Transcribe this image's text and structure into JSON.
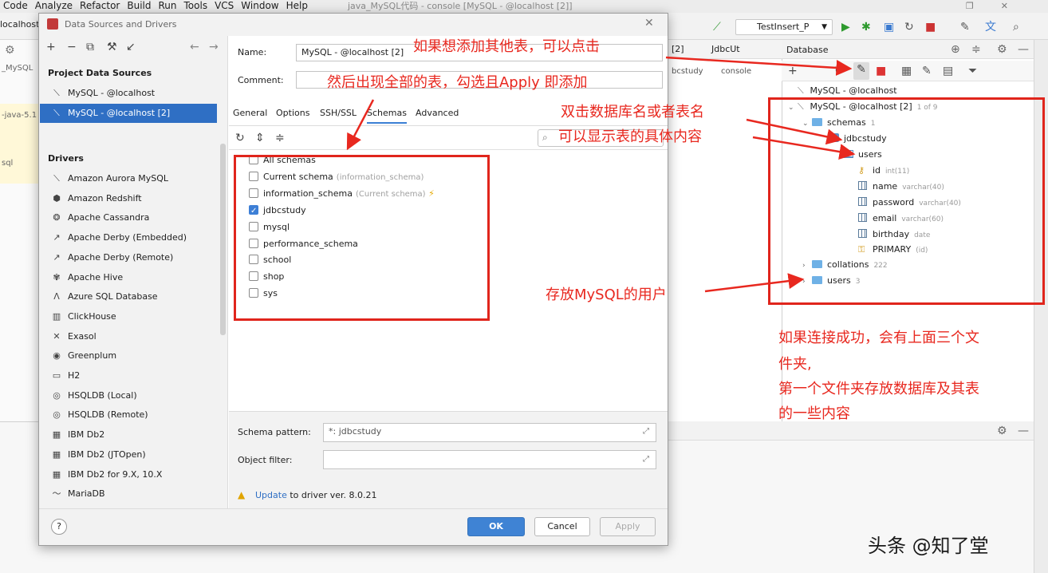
{
  "ide": {
    "menu": [
      "Code",
      "Analyze",
      "Refactor",
      "Build",
      "Run",
      "Tools",
      "VCS",
      "Window",
      "Help"
    ],
    "window_title": "java_MySQL代码 - console [MySQL - @localhost [2]]",
    "left_tab": "localhost",
    "left_strip": [
      "_MySQL",
      "-java-5.1",
      "sql"
    ],
    "run_config": "TestInsert_P",
    "editor_tabs": [
      "[2]",
      "JdbcUt"
    ],
    "editor_sub": [
      "bcstudy",
      "console"
    ]
  },
  "dialog": {
    "title": "Data Sources and Drivers",
    "project_header": "Project Data Sources",
    "project_sources": [
      {
        "label": "MySQL - @localhost",
        "selected": false
      },
      {
        "label": "MySQL - @localhost [2]",
        "selected": true
      }
    ],
    "drivers_header": "Drivers",
    "drivers": [
      {
        "label": "Amazon Aurora MySQL",
        "icon": "aurora-icon",
        "glyph": "⟍"
      },
      {
        "label": "Amazon Redshift",
        "icon": "redshift-icon",
        "glyph": "⬢"
      },
      {
        "label": "Apache Cassandra",
        "icon": "cassandra-icon",
        "glyph": "❂"
      },
      {
        "label": "Apache Derby (Embedded)",
        "icon": "derby-icon",
        "glyph": "↗"
      },
      {
        "label": "Apache Derby (Remote)",
        "icon": "derby-icon",
        "glyph": "↗"
      },
      {
        "label": "Apache Hive",
        "icon": "hive-icon",
        "glyph": "✾"
      },
      {
        "label": "Azure SQL Database",
        "icon": "azure-icon",
        "glyph": "Λ"
      },
      {
        "label": "ClickHouse",
        "icon": "clickhouse-icon",
        "glyph": "▥"
      },
      {
        "label": "Exasol",
        "icon": "exasol-icon",
        "glyph": "✕"
      },
      {
        "label": "Greenplum",
        "icon": "greenplum-icon",
        "glyph": "◉"
      },
      {
        "label": "H2",
        "icon": "h2-icon",
        "glyph": "▭"
      },
      {
        "label": "HSQLDB (Local)",
        "icon": "hsqldb-icon",
        "glyph": "◎"
      },
      {
        "label": "HSQLDB (Remote)",
        "icon": "hsqldb-icon",
        "glyph": "◎"
      },
      {
        "label": "IBM Db2",
        "icon": "db2-icon",
        "glyph": "▦"
      },
      {
        "label": "IBM Db2 (JTOpen)",
        "icon": "db2-icon",
        "glyph": "▦"
      },
      {
        "label": "IBM Db2 for 9.X, 10.X",
        "icon": "db2-icon",
        "glyph": "▦"
      },
      {
        "label": "MariaDB",
        "icon": "mariadb-icon",
        "glyph": "〜"
      }
    ],
    "name_label": "Name:",
    "name_value": "MySQL - @localhost [2]",
    "comment_label": "Comment:",
    "comment_value": "",
    "tabs": [
      "General",
      "Options",
      "SSH/SSL",
      "Schemas",
      "Advanced"
    ],
    "active_tab": "Schemas",
    "schemas": [
      {
        "name": "All schemas",
        "note": "",
        "checked": false
      },
      {
        "name": "Current schema",
        "note": "(information_schema)",
        "checked": false
      },
      {
        "name": "information_schema",
        "note": "(Current schema)",
        "checked": false
      },
      {
        "name": "jdbcstudy",
        "note": "",
        "checked": true
      },
      {
        "name": "mysql",
        "note": "",
        "checked": false
      },
      {
        "name": "performance_schema",
        "note": "",
        "checked": false
      },
      {
        "name": "school",
        "note": "",
        "checked": false
      },
      {
        "name": "shop",
        "note": "",
        "checked": false
      },
      {
        "name": "sys",
        "note": "",
        "checked": false
      }
    ],
    "schema_pattern_label": "Schema pattern:",
    "schema_pattern_value": "*: jdbcstudy",
    "object_filter_label": "Object filter:",
    "object_filter_value": "",
    "update_link": "Update",
    "update_text": " to driver ver. 8.0.21",
    "ok_label": "OK",
    "cancel_label": "Cancel",
    "apply_label": "Apply",
    "help_label": "?"
  },
  "database": {
    "title": "Database",
    "tree": [
      {
        "label": "MySQL - @localhost",
        "sub": "",
        "icon": "datasource-icon"
      },
      {
        "label": "MySQL - @localhost [2]",
        "sub": "1 of 9",
        "icon": "datasource-icon"
      },
      {
        "label": "schemas",
        "sub": "1",
        "icon": "folder-icon"
      },
      {
        "label": "jdbcstudy",
        "sub": "",
        "icon": "database-icon"
      },
      {
        "label": "users",
        "sub": "",
        "icon": "table-icon"
      },
      {
        "label": "id",
        "sub": "int(11)",
        "icon": "key-column-icon"
      },
      {
        "label": "name",
        "sub": "varchar(40)",
        "icon": "column-icon"
      },
      {
        "label": "password",
        "sub": "varchar(40)",
        "icon": "column-icon"
      },
      {
        "label": "email",
        "sub": "varchar(60)",
        "icon": "column-icon"
      },
      {
        "label": "birthday",
        "sub": "date",
        "icon": "column-icon"
      },
      {
        "label": "PRIMARY",
        "sub": "(id)",
        "icon": "key-icon"
      },
      {
        "label": "collations",
        "sub": "222",
        "icon": "folder-icon"
      },
      {
        "label": "users",
        "sub": "3",
        "icon": "folder-icon"
      }
    ]
  },
  "annotations": {
    "a1": "如果想添加其他表，可以点击",
    "a2": "然后出现全部的表，勾选且Apply 即添加",
    "a3_line1": "双击数据库名或者表名",
    "a3_line2": "可以显示表的具体内容",
    "a4": "存放MySQL的用户",
    "a5_line1": "如果连接成功，会有上面三个文",
    "a5_line2": "件夹,",
    "a5_line3": "第一个文件夹存放数据库及其表",
    "a5_line4": "的一些内容"
  },
  "watermark": "头条 @知了堂",
  "colors": {
    "annotation": "#e8281f",
    "selection": "#2f6fc4",
    "primary_button": "#3f83d4"
  }
}
